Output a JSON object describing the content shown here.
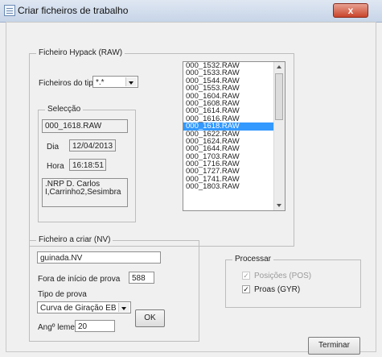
{
  "window": {
    "title": "Criar ficheiros de trabalho",
    "close_label": "x"
  },
  "raw_group": {
    "legend": "Ficheiro Hypack (RAW)",
    "type_label": "Ficheiros do tipo",
    "type_value": "*.*",
    "selection": {
      "legend": "Selecção",
      "filename": "000_1618.RAW",
      "day_label": "Dia",
      "day_value": "12/04/2013",
      "hour_label": "Hora",
      "hour_value": "16:18:51",
      "note": ".NRP D. Carlos\n I,Carrinho2,Sesimbra"
    },
    "files": [
      "000_1532.RAW",
      "000_1533.RAW",
      "000_1544.RAW",
      "000_1553.RAW",
      "000_1604.RAW",
      "000_1608.RAW",
      "000_1614.RAW",
      "000_1616.RAW",
      "000_1618.RAW",
      "000_1622.RAW",
      "000_1624.RAW",
      "000_1644.RAW",
      "000_1703.RAW",
      "000_1716.RAW",
      "000_1727.RAW",
      "000_1741.RAW",
      "000_1803.RAW"
    ],
    "selected_file": "000_1618.RAW"
  },
  "nv_group": {
    "legend": "Ficheiro a criar (NV)",
    "filename": "guinada.NV",
    "out_of_test_label": "Fora de início de prova",
    "out_of_test_value": "588",
    "test_type_label": "Tipo de prova",
    "test_type_value": "Curva de Giração EB",
    "angle_label": "Angº leme",
    "angle_value": "20",
    "ok_label": "OK"
  },
  "process_group": {
    "legend": "Processar",
    "positions_label": "Posições (POS)",
    "positions_checked": true,
    "positions_enabled": false,
    "bows_label": "Proas (GYR)",
    "bows_checked": true
  },
  "finish_label": "Terminar"
}
